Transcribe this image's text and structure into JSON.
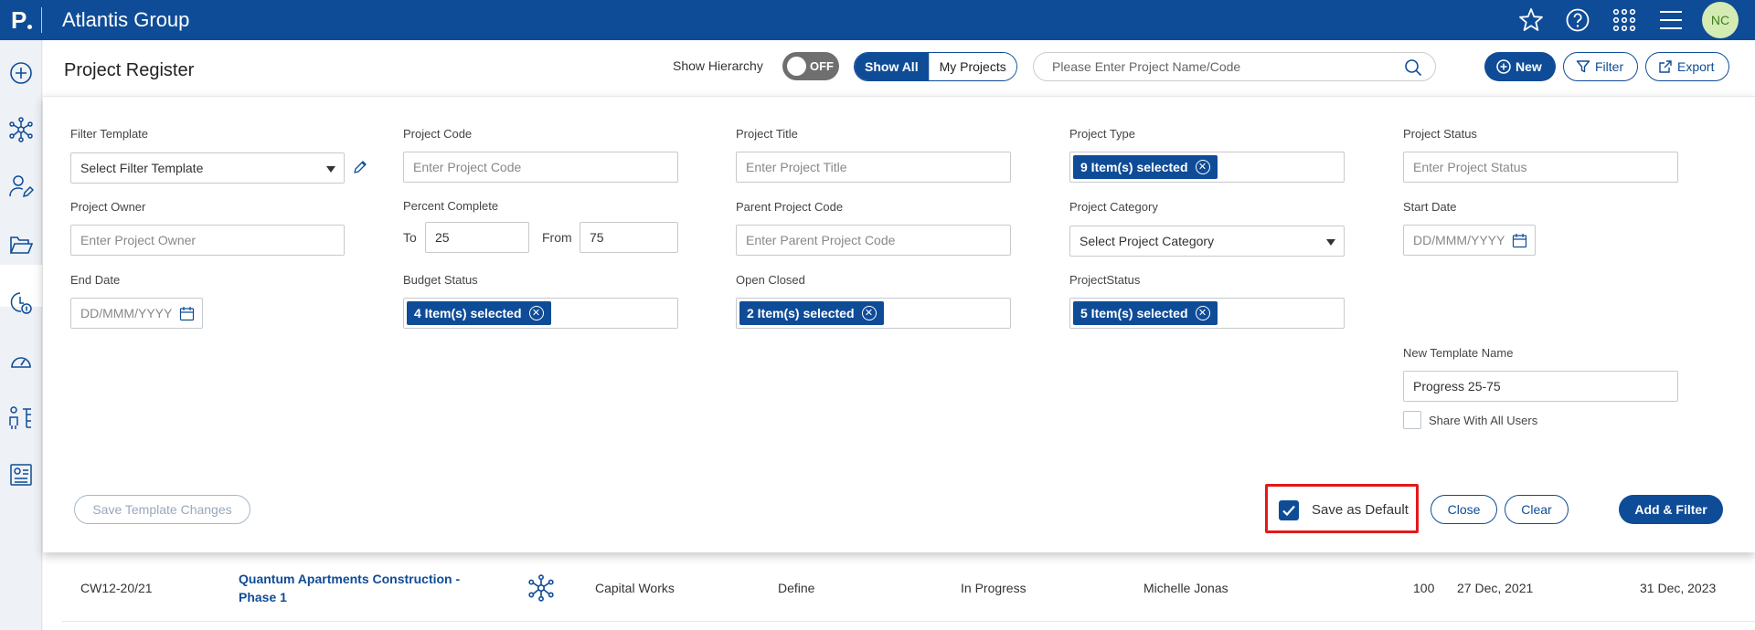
{
  "app": {
    "logo_letter": "P",
    "title": "Atlantis Group",
    "user_initials": "NC"
  },
  "header": {
    "page_title": "Project Register",
    "hierarchy_label": "Show Hierarchy",
    "hierarchy_toggle": "OFF",
    "view_options": [
      "Show All",
      "My Projects"
    ],
    "selected_view": "Show All",
    "search_placeholder": "Please Enter Project Name/Code",
    "new_label": "New",
    "filter_label": "Filter",
    "export_label": "Export"
  },
  "filters": {
    "filter_template": {
      "label": "Filter Template",
      "value": "Select Filter Template"
    },
    "project_code": {
      "label": "Project Code",
      "placeholder": "Enter Project Code"
    },
    "project_title": {
      "label": "Project Title",
      "placeholder": "Enter Project Title"
    },
    "project_type": {
      "label": "Project Type",
      "chip": "9 Item(s) selected"
    },
    "project_status": {
      "label": "Project Status",
      "placeholder": "Enter Project Status"
    },
    "project_owner": {
      "label": "Project Owner",
      "placeholder": "Enter Project Owner"
    },
    "percent_complete": {
      "label": "Percent Complete",
      "to_label": "To",
      "to_value": "25",
      "from_label": "From",
      "from_value": "75"
    },
    "parent_project_code": {
      "label": "Parent Project Code",
      "placeholder": "Enter Parent Project Code"
    },
    "project_category": {
      "label": "Project Category",
      "value": "Select Project Category"
    },
    "start_date": {
      "label": "Start Date",
      "placeholder": "DD/MMM/YYYY"
    },
    "end_date": {
      "label": "End Date",
      "placeholder": "DD/MMM/YYYY"
    },
    "budget_status": {
      "label": "Budget Status",
      "chip": "4 Item(s) selected"
    },
    "open_closed": {
      "label": "Open Closed",
      "chip": "2 Item(s) selected"
    },
    "project_status2": {
      "label": "ProjectStatus",
      "chip": "5 Item(s) selected"
    },
    "new_template_name": {
      "label": "New Template Name",
      "value": "Progress 25-75"
    },
    "share_with_all": {
      "label": "Share With All Users",
      "checked": false
    }
  },
  "panel_actions": {
    "save_template_changes": "Save Template Changes",
    "save_as_default": "Save as Default",
    "save_as_default_checked": true,
    "close": "Close",
    "clear": "Clear",
    "add_filter": "Add & Filter"
  },
  "table": {
    "rows": [
      {
        "code": "CW12-20/21",
        "title_line1": "Quantum Apartments Construction -",
        "title_line2": "Phase 1",
        "type": "Capital Works",
        "stage": "Define",
        "status": "In Progress",
        "owner": "Michelle Jonas",
        "percent": "100",
        "start": "27 Dec, 2021",
        "end": "31 Dec, 2023"
      }
    ]
  },
  "colors": {
    "brand": "#0f4c97",
    "highlight": "#e2191a",
    "avatar_bg": "#d4ecb3"
  }
}
